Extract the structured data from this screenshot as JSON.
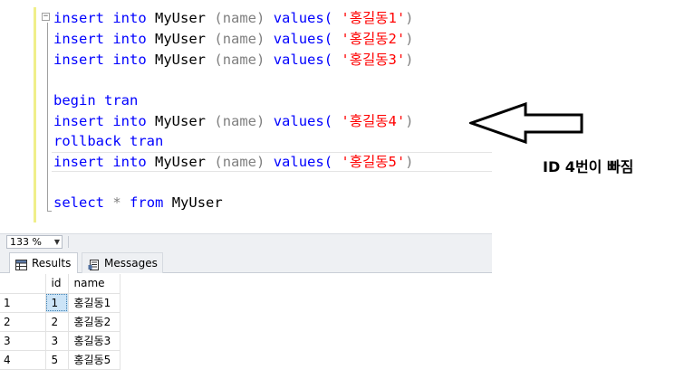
{
  "editor": {
    "collapse_glyph": "⊟",
    "lines": [
      {
        "kw1": "insert",
        "kw2": "into",
        "table": "MyUser",
        "cols": "(name)",
        "kw3": "values(",
        "str": "'홍길동1'",
        "close": ")"
      },
      {
        "kw1": "insert",
        "kw2": "into",
        "table": "MyUser",
        "cols": "(name)",
        "kw3": "values(",
        "str": "'홍길동2'",
        "close": ")"
      },
      {
        "kw1": "insert",
        "kw2": "into",
        "table": "MyUser",
        "cols": "(name)",
        "kw3": "values(",
        "str": "'홍길동3'",
        "close": ")"
      },
      {
        "kw1": "insert",
        "kw2": "into",
        "table": "MyUser",
        "cols": "(name)",
        "kw3": "values(",
        "str": "'홍길동4'",
        "close": ")"
      },
      {
        "kw1": "insert",
        "kw2": "into",
        "table": "MyUser",
        "cols": "(name)",
        "kw3": "values(",
        "str": "'홍길동5'",
        "close": ")"
      }
    ],
    "begin_tran": "begin tran",
    "rollback_tran": "rollback tran",
    "select_kw": "select",
    "select_star": "*",
    "from_kw": "from",
    "select_table": "MyUser"
  },
  "annotation": {
    "text": "ID 4번이 빠짐"
  },
  "zoom": {
    "value": "133 %",
    "caret": "▼"
  },
  "tabs": {
    "results": "Results",
    "messages": "Messages"
  },
  "grid": {
    "columns": [
      "id",
      "name"
    ],
    "rows": [
      {
        "n": "1",
        "id": "1",
        "name": "홍길동1"
      },
      {
        "n": "2",
        "id": "2",
        "name": "홍길동2"
      },
      {
        "n": "3",
        "id": "3",
        "name": "홍길동3"
      },
      {
        "n": "4",
        "id": "5",
        "name": "홍길동5"
      }
    ]
  }
}
